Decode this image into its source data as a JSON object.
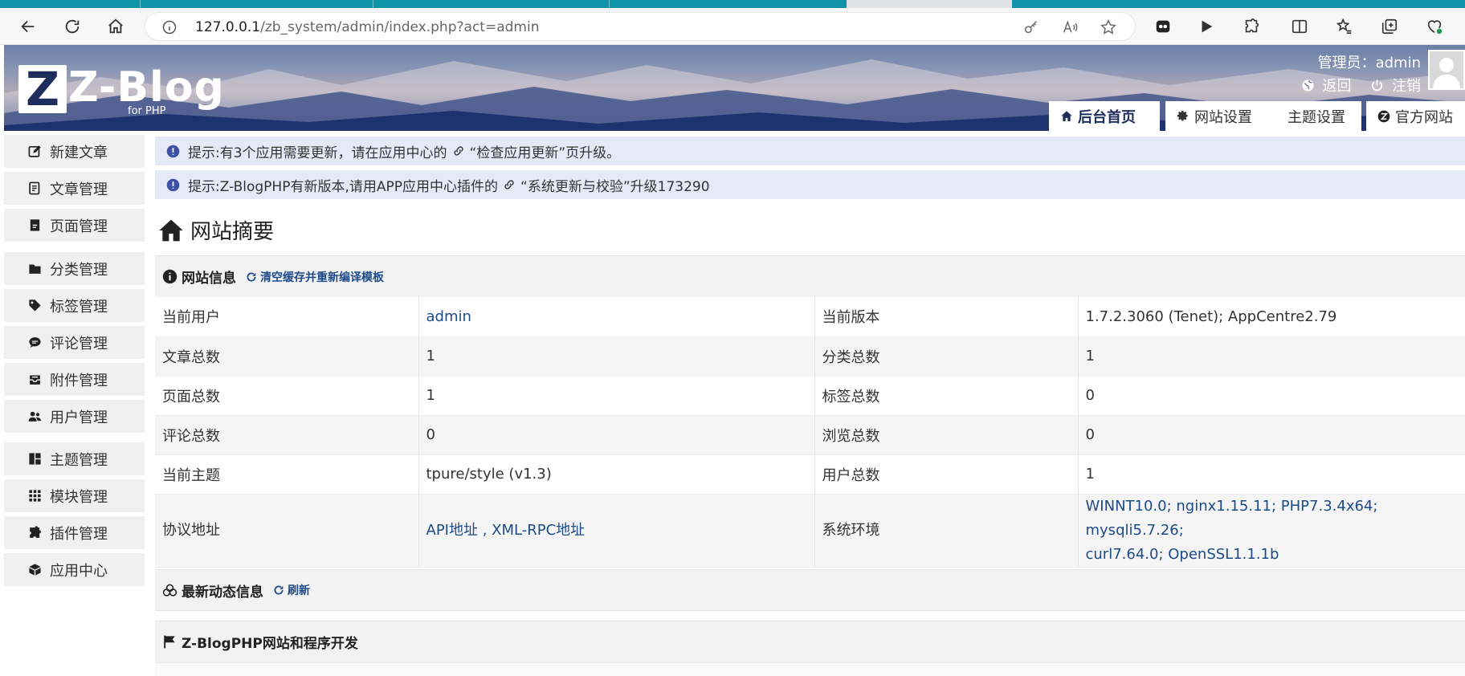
{
  "browser": {
    "url_host": "127.0.0.1",
    "url_path": "/zb_system/admin/index.php?act=admin"
  },
  "header": {
    "brand": "Z-Blog",
    "logo_letter": "Z",
    "brand_sub": "for PHP",
    "admin_label": "管理员：admin",
    "back_label": "返回",
    "logout_label": "注销",
    "nav": [
      {
        "label": "后台首页",
        "icon": "home-icon",
        "active": true
      },
      {
        "label": "网站设置",
        "icon": "gear-icon"
      },
      {
        "label": "主题设置"
      },
      {
        "label": "官方网站",
        "icon": "zblog-icon"
      }
    ]
  },
  "sidebar": {
    "items": [
      {
        "label": "新建文章",
        "icon": "edit-icon"
      },
      {
        "label": "文章管理",
        "icon": "article-icon"
      },
      {
        "label": "页面管理",
        "icon": "page-icon"
      },
      {
        "label": "分类管理",
        "icon": "folder-icon"
      },
      {
        "label": "标签管理",
        "icon": "tag-icon"
      },
      {
        "label": "评论管理",
        "icon": "comment-icon"
      },
      {
        "label": "附件管理",
        "icon": "inbox-icon"
      },
      {
        "label": "用户管理",
        "icon": "users-icon"
      },
      {
        "label": "主题管理",
        "icon": "layout-icon"
      },
      {
        "label": "模块管理",
        "icon": "grid-icon"
      },
      {
        "label": "插件管理",
        "icon": "puzzle-icon"
      },
      {
        "label": "应用中心",
        "icon": "box-icon"
      }
    ]
  },
  "notices": [
    {
      "prefix": "提示:有3个应用需要更新，请在应用中心的",
      "link": "“检查应用更新”页升级。"
    },
    {
      "prefix": "提示:Z-BlogPHP有新版本,请用APP应用中心插件的",
      "link": "“系统更新与校验”升级173290"
    }
  ],
  "main": {
    "title": "网站摘要",
    "site_info": {
      "heading": "网站信息",
      "action": "清空缓存并重新编译模板",
      "rows": [
        [
          "当前用户",
          "admin",
          "当前版本",
          "1.7.2.3060 (Tenet); AppCentre2.79"
        ],
        [
          "文章总数",
          "1",
          "分类总数",
          "1"
        ],
        [
          "页面总数",
          "1",
          "标签总数",
          "0"
        ],
        [
          "评论总数",
          "0",
          "浏览总数",
          "0"
        ],
        [
          "当前主题",
          "tpure/style (v1.3)",
          "用户总数",
          "1"
        ]
      ],
      "protocol_label": "协议地址",
      "api_link": "API地址",
      "xmlrpc_link": "XML-RPC地址",
      "env_label": "系统环境",
      "env_line1": "WINNT10.0; nginx1.15.11; PHP7.3.4x64; mysqli5.7.26;",
      "env_line2": "curl7.64.0; OpenSSL1.1.1b"
    },
    "news": {
      "heading": "最新动态信息",
      "action": "刷新"
    },
    "dev": {
      "heading": "Z-BlogPHP网站和程序开发"
    }
  }
}
